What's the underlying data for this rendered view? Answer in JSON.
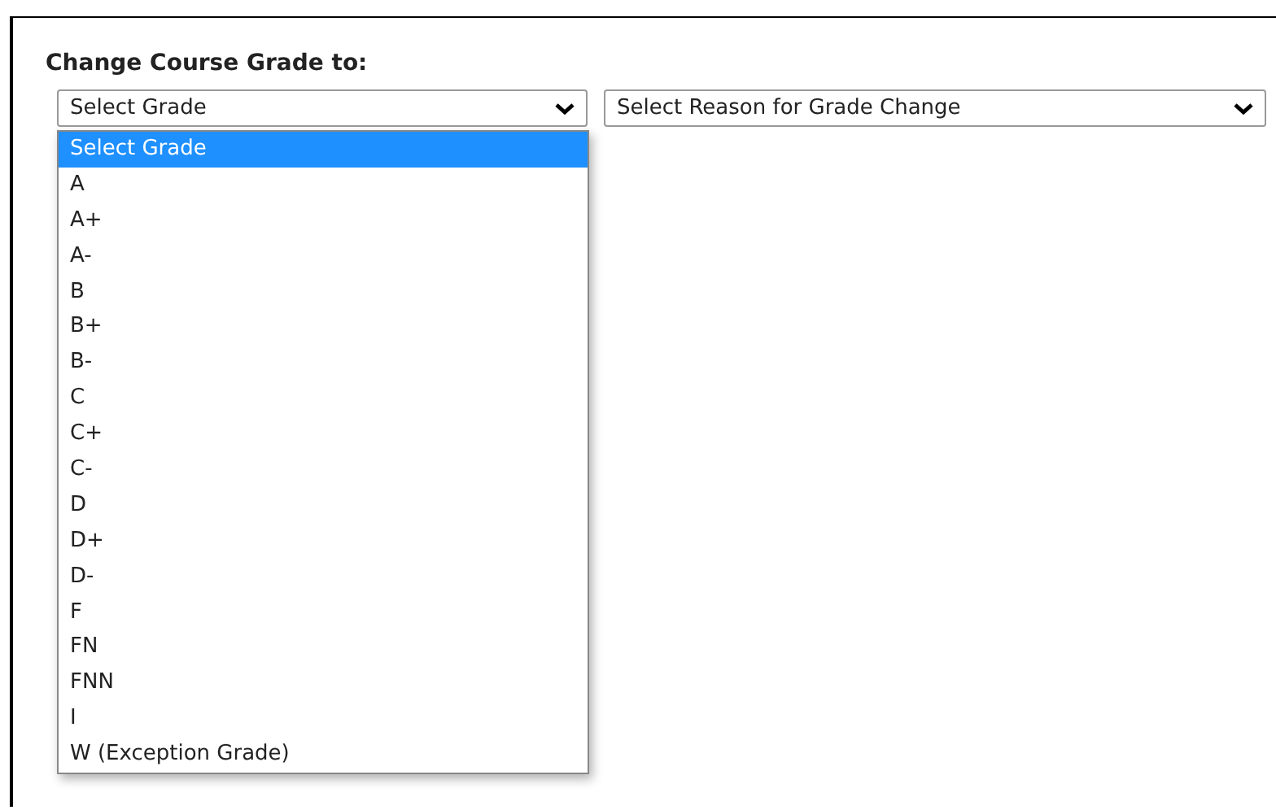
{
  "heading": "Change Course Grade to:",
  "grade_select": {
    "value": "Select Grade",
    "expanded": true
  },
  "reason_select": {
    "value": "Select Reason for Grade Change"
  },
  "grade_options": [
    {
      "label": "Select Grade",
      "selected": true
    },
    {
      "label": "A",
      "selected": false
    },
    {
      "label": "A+",
      "selected": false
    },
    {
      "label": "A-",
      "selected": false
    },
    {
      "label": "B",
      "selected": false
    },
    {
      "label": "B+",
      "selected": false
    },
    {
      "label": "B-",
      "selected": false
    },
    {
      "label": "C",
      "selected": false
    },
    {
      "label": "C+",
      "selected": false
    },
    {
      "label": "C-",
      "selected": false
    },
    {
      "label": "D",
      "selected": false
    },
    {
      "label": "D+",
      "selected": false
    },
    {
      "label": "D-",
      "selected": false
    },
    {
      "label": "F",
      "selected": false
    },
    {
      "label": "FN",
      "selected": false
    },
    {
      "label": "FNN",
      "selected": false
    },
    {
      "label": "I",
      "selected": false
    },
    {
      "label": "W (Exception Grade)",
      "selected": false
    }
  ]
}
